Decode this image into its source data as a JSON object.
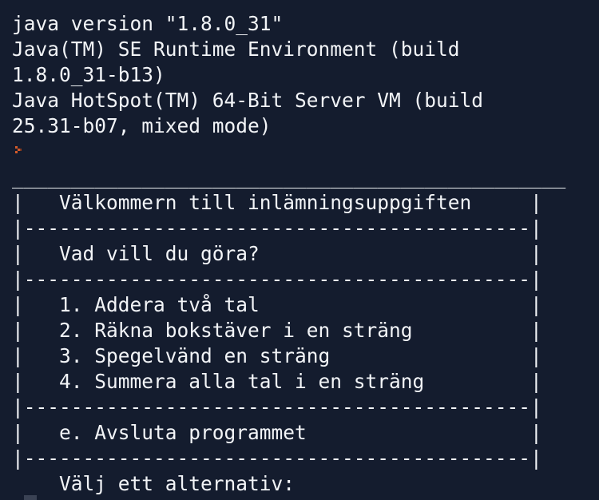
{
  "colors": {
    "background": "#141c2e",
    "text": "#f2f4f7",
    "prompt_glyph": "#d35a2a",
    "cursor": "#3a4254"
  },
  "terminal": {
    "lines": [
      "java version \"1.8.0_31\"",
      "Java(TM) SE Runtime Environment (build",
      "1.8.0_31-b13)",
      "Java HotSpot(TM) 64-Bit Server VM (build",
      "25.31-b07, mixed mode)"
    ],
    "prompt_icon": "orange-arrow-prompt-icon",
    "menu": {
      "top_border": "_______________________________________________",
      "title_row": "|   Välkommern till inlämningsuppgiften     |",
      "divider_1": "|-------------------------------------------|",
      "question_row": "|   Vad vill du göra?                       |",
      "divider_2": "|-------------------------------------------|",
      "option_1": "|   1. Addera två tal                       |",
      "option_2": "|   2. Räkna bokstäver i en sträng          |",
      "option_3": "|   3. Spegelvänd en sträng                 |",
      "option_4": "|   4. Summera alla tal i en sträng         |",
      "divider_3": "|-------------------------------------------|",
      "exit_row": "|   e. Avsluta programmet                   |",
      "divider_4": "|-------------------------------------------|",
      "input_prompt": "    Välj ett alternativ:"
    }
  }
}
